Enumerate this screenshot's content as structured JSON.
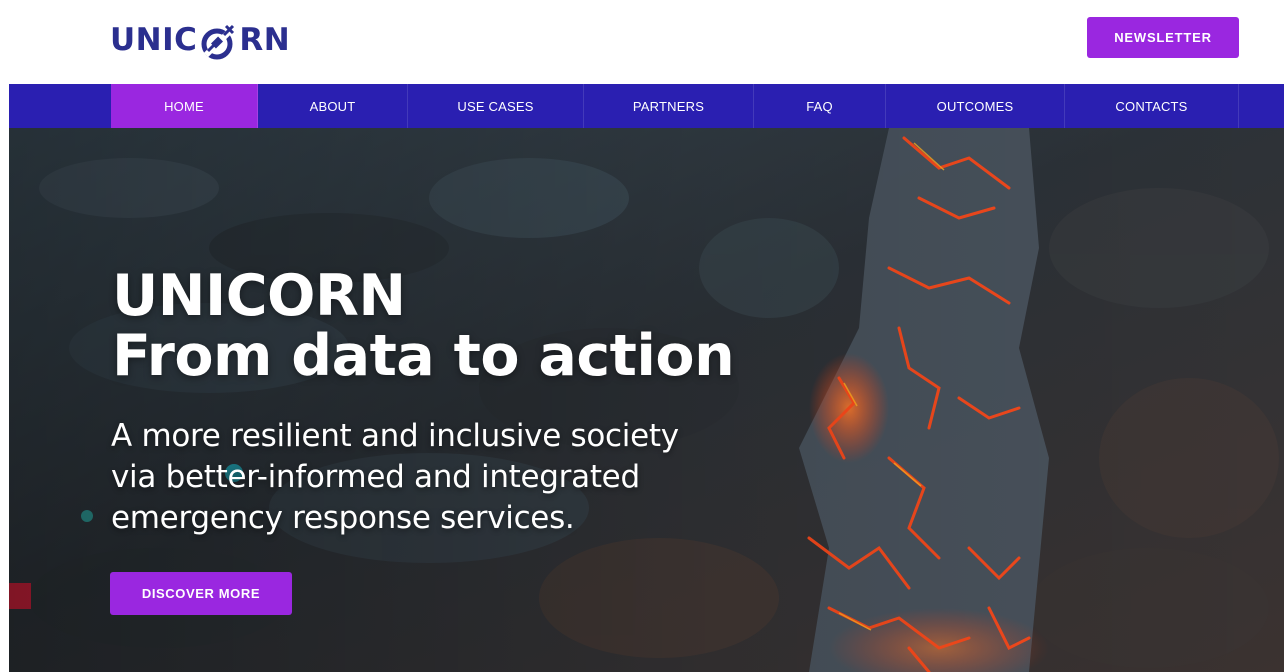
{
  "header": {
    "logo": {
      "text_before": "UNIC",
      "text_after": "RN",
      "icon": "unicorn-satellite-logo-icon",
      "color": "#2b2f8f"
    },
    "newsletter_label": "NEWSLETTER"
  },
  "nav": {
    "items": [
      {
        "label": "HOME",
        "active": true
      },
      {
        "label": "ABOUT",
        "active": false
      },
      {
        "label": "USE CASES",
        "active": false
      },
      {
        "label": "PARTNERS",
        "active": false
      },
      {
        "label": "FAQ",
        "active": false
      },
      {
        "label": "OUTCOMES",
        "active": false
      },
      {
        "label": "CONTACTS",
        "active": false
      }
    ]
  },
  "hero": {
    "title_line1": "UNICORN",
    "title_line2": "From data to action",
    "subtitle_line1": "A more resilient and inclusive society",
    "subtitle_line2": "via better-informed and integrated",
    "subtitle_line3": "emergency response services.",
    "cta_label": "DISCOVER MORE",
    "background": "lava-flow-aerial-photo"
  },
  "colors": {
    "accent": "#9a27e0",
    "nav_bg": "#2a1fb1",
    "brand": "#2b2f8f",
    "lava": "#ff4a1a"
  }
}
